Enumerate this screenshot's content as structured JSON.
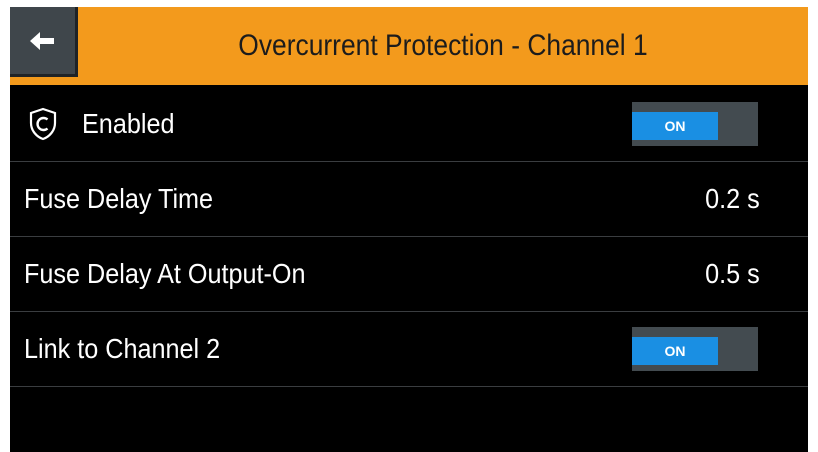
{
  "header": {
    "back_icon": "arrow-left-icon",
    "title": "Overcurrent Protection - Channel 1",
    "background": "#f39a1c"
  },
  "rows": [
    {
      "label": "Enabled",
      "icon": "shield-c-icon",
      "control": "toggle",
      "toggle_label": "ON",
      "state": "on"
    },
    {
      "label": "Fuse Delay Time",
      "value": "0.2 s"
    },
    {
      "label": "Fuse Delay At Output-On",
      "value": "0.5 s"
    },
    {
      "label": "Link to Channel 2",
      "control": "toggle",
      "toggle_label": "ON",
      "state": "on"
    }
  ],
  "colors": {
    "accent": "#f39a1c",
    "toggle_on": "#1a8fe3",
    "toggle_track": "#434b50",
    "background": "#000000"
  }
}
